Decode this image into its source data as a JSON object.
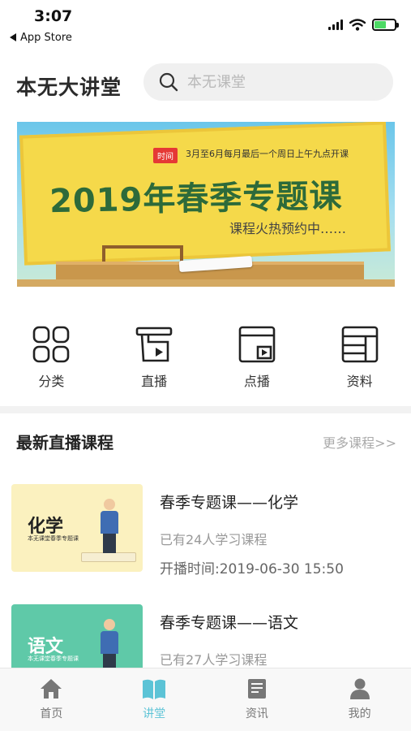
{
  "status_bar": {
    "time": "3:07",
    "back_label": "App Store"
  },
  "header": {
    "app_title": "本无大讲堂",
    "search_placeholder": "本无课堂"
  },
  "banner": {
    "tag": "时间",
    "schedule": "3月至6月每月最后一个周日上午九点开课",
    "headline": "2019年春季专题课",
    "subline": "课程火热预约中……"
  },
  "shortcuts": [
    {
      "label": "分类",
      "icon": "category-grid-icon"
    },
    {
      "label": "直播",
      "icon": "live-broadcast-icon"
    },
    {
      "label": "点播",
      "icon": "video-on-demand-icon"
    },
    {
      "label": "资料",
      "icon": "materials-icon"
    }
  ],
  "section": {
    "title": "最新直播课程",
    "more_link": "更多课程>>"
  },
  "courses": [
    {
      "thumb_subject": "化学",
      "thumb_caption": "本无课堂春季专题课",
      "thumb_color": "#fbf1bf",
      "title": "春季专题课——化学",
      "learners": "已有24人学习课程",
      "start_time": "开播时间:2019-06-30 15:50"
    },
    {
      "thumb_subject": "语文",
      "thumb_caption": "本无课堂春季专题课",
      "thumb_color": "#5fc9a8",
      "title": "春季专题课——语文",
      "learners": "已有27人学习课程",
      "start_time": ""
    }
  ],
  "tabbar": {
    "active_index": 1,
    "active_color": "#5cc3d6",
    "inactive_color": "#777777",
    "tabs": [
      {
        "label": "首页",
        "icon": "home-icon"
      },
      {
        "label": "讲堂",
        "icon": "book-open-icon"
      },
      {
        "label": "资讯",
        "icon": "news-icon"
      },
      {
        "label": "我的",
        "icon": "profile-icon"
      }
    ]
  }
}
